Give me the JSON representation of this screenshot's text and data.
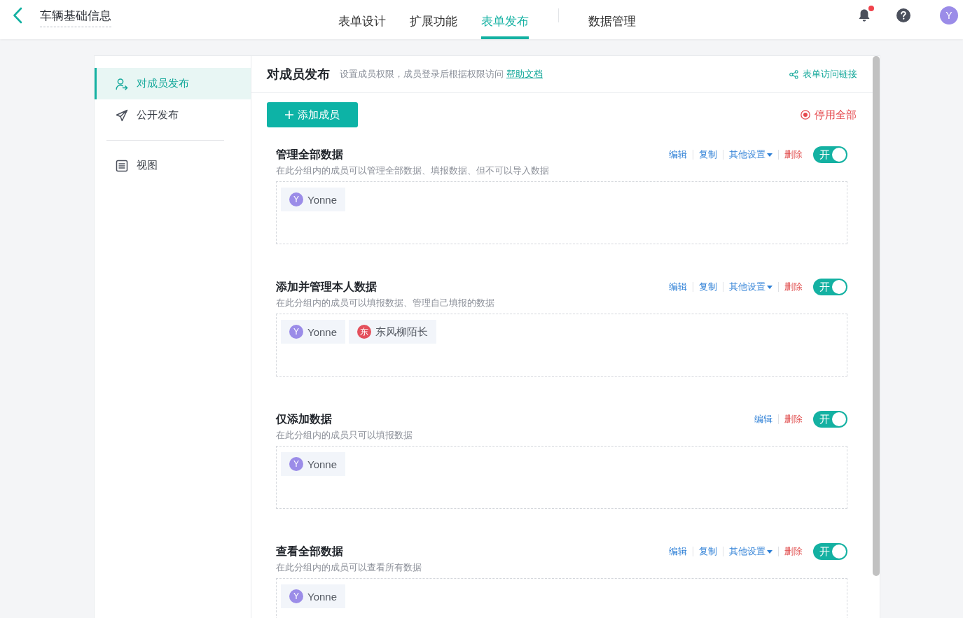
{
  "top_bar": {
    "title": "车辆基础信息",
    "tab_groups": [
      {
        "tabs": [
          {
            "label": "表单设计",
            "selected": false
          },
          {
            "label": "扩展功能",
            "selected": false
          },
          {
            "label": "表单发布",
            "selected": true
          }
        ]
      },
      {
        "tabs": [
          {
            "label": "数据管理",
            "selected": false
          }
        ]
      }
    ],
    "notifications": {
      "unread": true
    },
    "user": {
      "initial": "Y"
    }
  },
  "sidebar": {
    "sections": [
      {
        "items": [
          {
            "label": "对成员发布",
            "selected": true
          },
          {
            "label": "公开发布",
            "selected": false
          }
        ]
      },
      {
        "items": [
          {
            "label": "视图",
            "selected": false
          }
        ]
      }
    ]
  },
  "panel": {
    "title": "对成员发布",
    "description": "设置成员权限，成员登录后根据权限访问",
    "help_link": "帮助文档",
    "access_link": "表单访问链接",
    "add_button": "添加成员",
    "disable_all": "停用全部",
    "groups": [
      {
        "title": "管理全部数据",
        "description": "在此分组内的成员可以管理全部数据、填报数据、但不可以导入数据",
        "actions": [
          {
            "label": "编辑",
            "kind": "link"
          },
          {
            "label": "复制",
            "kind": "link"
          },
          {
            "label": "其他设置",
            "kind": "menu"
          },
          {
            "label": "删除",
            "kind": "danger"
          }
        ],
        "toggle": {
          "label": "开",
          "on": true
        },
        "members": [
          {
            "initial": "Y",
            "name": "Yonne",
            "color": "#9b8ce8"
          }
        ]
      },
      {
        "title": "添加并管理本人数据",
        "description": "在此分组内的成员可以填报数据、管理自己填报的数据",
        "actions": [
          {
            "label": "编辑",
            "kind": "link"
          },
          {
            "label": "复制",
            "kind": "link"
          },
          {
            "label": "其他设置",
            "kind": "menu"
          },
          {
            "label": "删除",
            "kind": "danger"
          }
        ],
        "toggle": {
          "label": "开",
          "on": true
        },
        "members": [
          {
            "initial": "Y",
            "name": "Yonne",
            "color": "#9b8ce8"
          },
          {
            "initial": "东",
            "name": "东风柳陌长",
            "color": "#e4505c"
          }
        ]
      },
      {
        "title": "仅添加数据",
        "description": "在此分组内的成员只可以填报数据",
        "actions": [
          {
            "label": "编辑",
            "kind": "link"
          },
          {
            "label": "删除",
            "kind": "danger"
          }
        ],
        "toggle": {
          "label": "开",
          "on": true
        },
        "members": [
          {
            "initial": "Y",
            "name": "Yonne",
            "color": "#9b8ce8"
          }
        ]
      },
      {
        "title": "查看全部数据",
        "description": "在此分组内的成员可以查看所有数据",
        "actions": [
          {
            "label": "编辑",
            "kind": "link"
          },
          {
            "label": "复制",
            "kind": "link"
          },
          {
            "label": "其他设置",
            "kind": "menu"
          },
          {
            "label": "删除",
            "kind": "danger"
          }
        ],
        "toggle": {
          "label": "开",
          "on": true
        },
        "members": [
          {
            "initial": "Y",
            "name": "Yonne",
            "color": "#9b8ce8"
          }
        ]
      }
    ]
  }
}
